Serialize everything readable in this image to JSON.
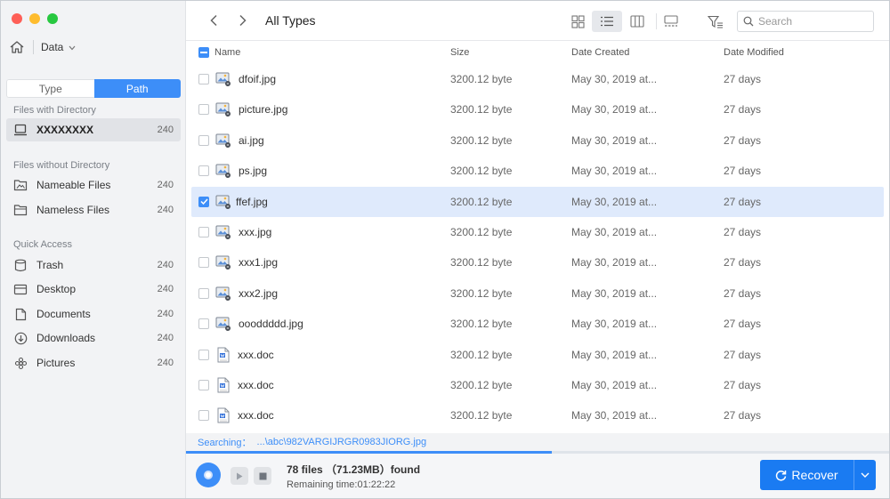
{
  "sidebar": {
    "location": "Data",
    "tabs": {
      "type": "Type",
      "path": "Path"
    },
    "with_dir_title": "Files with Directory",
    "directory_item": {
      "label": "XXXXXXXX",
      "count": "240"
    },
    "without_dir_title": "Files without Directory",
    "without_dir_items": [
      {
        "label": "Nameable Files",
        "count": "240",
        "icon": "folder-image-icon"
      },
      {
        "label": "Nameless Files",
        "count": "240",
        "icon": "folder-icon"
      }
    ],
    "quick_access_title": "Quick Access",
    "quick_access_items": [
      {
        "label": "Trash",
        "count": "240",
        "icon": "trash-icon"
      },
      {
        "label": "Desktop",
        "count": "240",
        "icon": "desktop-icon"
      },
      {
        "label": "Documents",
        "count": "240",
        "icon": "documents-icon"
      },
      {
        "label": "Ddownloads",
        "count": "240",
        "icon": "download-icon"
      },
      {
        "label": "Pictures",
        "count": "240",
        "icon": "pictures-icon"
      }
    ]
  },
  "toolbar": {
    "title": "All Types",
    "search_placeholder": "Search"
  },
  "table": {
    "headers": {
      "name": "Name",
      "size": "Size",
      "created": "Date Created",
      "modified": "Date Modified"
    },
    "rows": [
      {
        "name": "dfoif.jpg",
        "size": "3200.12 byte",
        "created": "May 30, 2019 at...",
        "modified": "27 days",
        "kind": "image",
        "checked": false
      },
      {
        "name": "picture.jpg",
        "size": "3200.12 byte",
        "created": "May 30, 2019 at...",
        "modified": "27 days",
        "kind": "image",
        "checked": false
      },
      {
        "name": "ai.jpg",
        "size": "3200.12 byte",
        "created": "May 30, 2019 at...",
        "modified": "27 days",
        "kind": "image",
        "checked": false
      },
      {
        "name": "ps.jpg",
        "size": "3200.12 byte",
        "created": "May 30, 2019 at...",
        "modified": "27 days",
        "kind": "image",
        "checked": false
      },
      {
        "name": "ffef.jpg",
        "size": "3200.12 byte",
        "created": "May 30, 2019 at...",
        "modified": "27 days",
        "kind": "image",
        "checked": true
      },
      {
        "name": "xxx.jpg",
        "size": "3200.12 byte",
        "created": "May 30, 2019 at...",
        "modified": "27 days",
        "kind": "image",
        "checked": false
      },
      {
        "name": "xxx1.jpg",
        "size": "3200.12 byte",
        "created": "May 30, 2019 at...",
        "modified": "27 days",
        "kind": "image",
        "checked": false
      },
      {
        "name": "xxx2.jpg",
        "size": "3200.12 byte",
        "created": "May 30, 2019 at...",
        "modified": "27 days",
        "kind": "image",
        "checked": false
      },
      {
        "name": "oooddddd.jpg",
        "size": "3200.12 byte",
        "created": "May 30, 2019 at...",
        "modified": "27 days",
        "kind": "image",
        "checked": false
      },
      {
        "name": "xxx.doc",
        "size": "3200.12 byte",
        "created": "May 30, 2019 at...",
        "modified": "27 days",
        "kind": "doc",
        "checked": false
      },
      {
        "name": "xxx.doc",
        "size": "3200.12 byte",
        "created": "May 30, 2019 at...",
        "modified": "27 days",
        "kind": "doc",
        "checked": false
      },
      {
        "name": "xxx.doc",
        "size": "3200.12 byte",
        "created": "May 30, 2019 at...",
        "modified": "27 days",
        "kind": "doc",
        "checked": false
      }
    ]
  },
  "status": {
    "searching_label": "Searching：",
    "searching_path": "...\\abc\\982VARGIJRGR0983JIORG.jpg",
    "progress_fraction": 0.52,
    "found": "78 files （71.23MB）found",
    "remaining": "Remaining time:01:22:22"
  },
  "recover": {
    "label": "Recover"
  },
  "colors": {
    "accent": "#3d8ef8",
    "button": "#1a7bf2",
    "selected_row": "#dfeafc"
  }
}
